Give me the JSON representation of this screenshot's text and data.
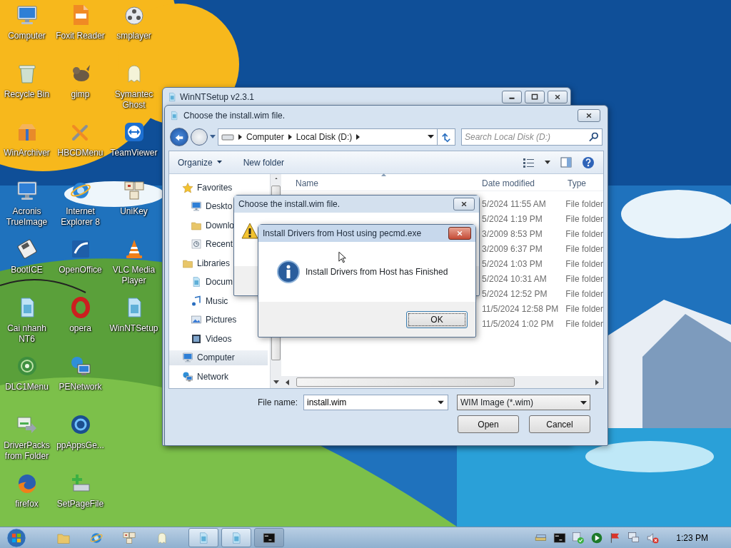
{
  "desktop_icons": [
    {
      "label": "Computer"
    },
    {
      "label": "Recycle Bin"
    },
    {
      "label": "WinArchiver"
    },
    {
      "label": "Acronis TrueImage"
    },
    {
      "label": "BootICE"
    },
    {
      "label": "Cai nhanh NT6"
    },
    {
      "label": "DLC1Menu"
    },
    {
      "label": "DriverPacks from Folder"
    },
    {
      "label": "firefox"
    },
    {
      "label": "Foxit Reader"
    },
    {
      "label": "gimp"
    },
    {
      "label": "HBCDMenu"
    },
    {
      "label": "Internet Explorer 8"
    },
    {
      "label": "OpenOffice"
    },
    {
      "label": "opera"
    },
    {
      "label": "PENetwork"
    },
    {
      "label": "ppAppsGe..."
    },
    {
      "label": "SetPageFile"
    },
    {
      "label": "smplayer"
    },
    {
      "label": "Symantec Ghost"
    },
    {
      "label": "TeamViewer"
    },
    {
      "label": "UniKey"
    },
    {
      "label": "VLC Media Player"
    },
    {
      "label": "WinNTSetup"
    }
  ],
  "background_window": {
    "title": "WinNTSetup v2.3.1"
  },
  "file_dialog": {
    "title": "Choose the install.wim file.",
    "breadcrumb": [
      "Computer",
      "Local Disk (D:)"
    ],
    "search": {
      "placeholder": "Search Local Disk (D:)"
    },
    "toolbar": [
      "Organize",
      "New folder"
    ],
    "nav": [
      {
        "label": "Favorites",
        "selected": false,
        "children": [
          {
            "label": "Deskto",
            "selected": false
          },
          {
            "label": "Downlo",
            "selected": false
          },
          {
            "label": "Recent",
            "selected": false
          }
        ]
      },
      {
        "label": "Libraries",
        "selected": false,
        "children": [
          {
            "label": "Docum",
            "selected": false
          },
          {
            "label": "Music",
            "selected": false
          },
          {
            "label": "Pictures",
            "selected": false
          },
          {
            "label": "Videos",
            "selected": false
          }
        ]
      },
      {
        "label": "Computer",
        "selected": true
      },
      {
        "label": "Network",
        "selected": false
      }
    ],
    "columns": [
      "Name",
      "Date modified",
      "Type"
    ],
    "rows": [
      {
        "date": "5/2024 11:55 AM",
        "type": "File folder"
      },
      {
        "date": "5/2024 1:19 PM",
        "type": "File folder"
      },
      {
        "date": "3/2009 8:53 PM",
        "type": "File folder"
      },
      {
        "date": "3/2009 6:37 PM",
        "type": "File folder"
      },
      {
        "date": "5/2024 1:03 PM",
        "type": "File folder"
      },
      {
        "date": "5/2024 10:31 AM",
        "type": "File folder"
      },
      {
        "date": "5/2024 12:52 PM",
        "type": "File folder"
      },
      {
        "date": "11/5/2024 12:58 PM",
        "type": "File folder"
      },
      {
        "date": "11/5/2024 1:02 PM",
        "type": "File folder"
      }
    ],
    "file_name": {
      "label": "File name:",
      "value": "install.wim"
    },
    "file_type": "WIM Image (*.wim)",
    "buttons": [
      "Open",
      "Cancel"
    ]
  },
  "message_box": {
    "title": "Choose the install.wim file."
  },
  "info_dialog": {
    "title": "Install Drivers from Host using pecmd.exe",
    "message": "Install Drivers from Host has Finished",
    "button": "OK"
  },
  "taskbar": {
    "clock": "1:23 PM"
  }
}
